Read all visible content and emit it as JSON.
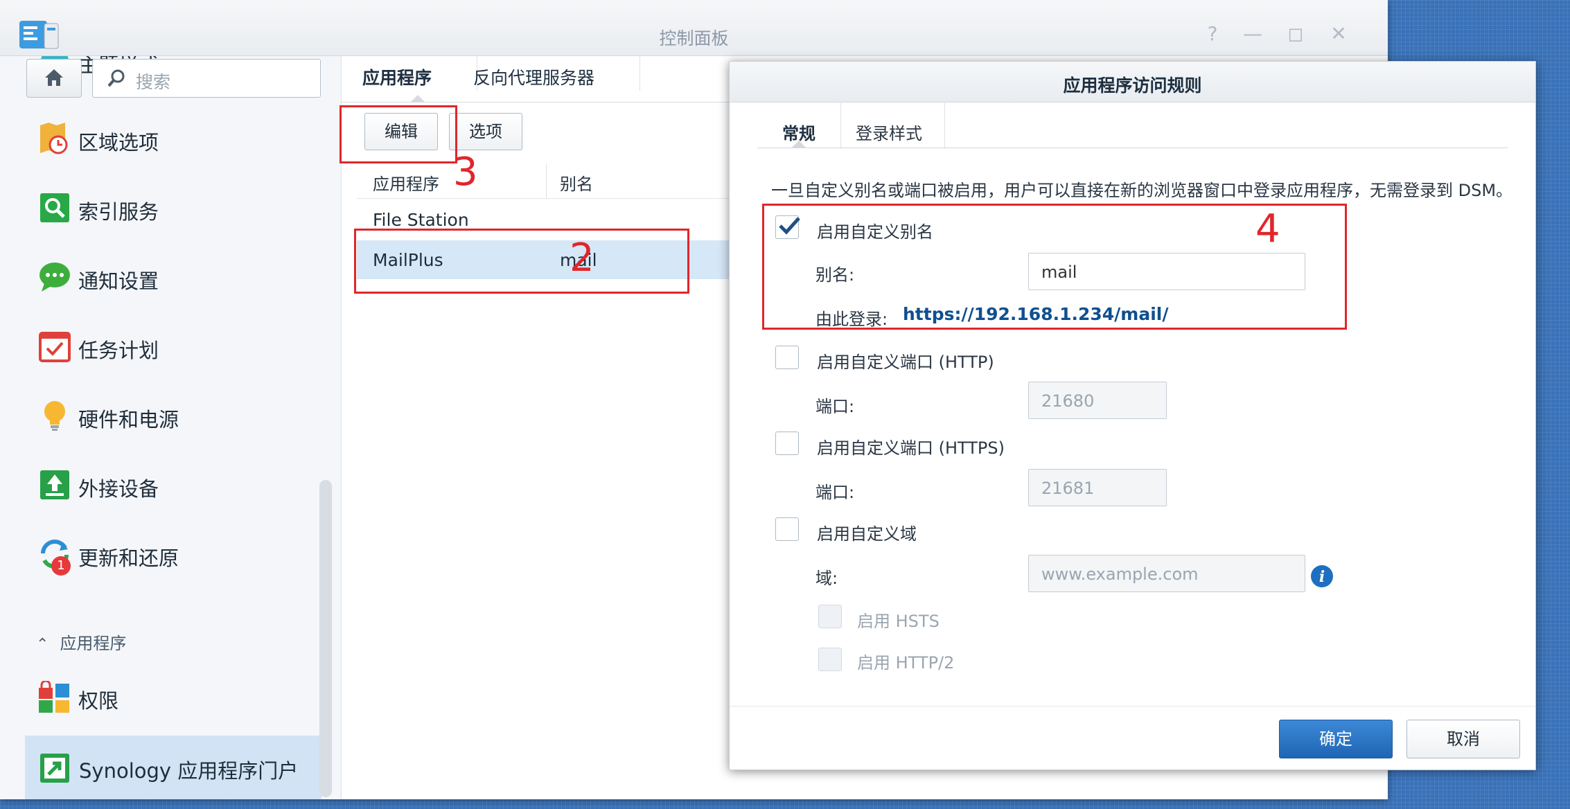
{
  "window": {
    "title": "控制面板"
  },
  "search": {
    "placeholder": "搜索"
  },
  "sidebar": {
    "partial_item": "主题样式",
    "items": [
      {
        "label": "区域选项",
        "icon": "clock-map-icon"
      },
      {
        "label": "索引服务",
        "icon": "index-search-icon"
      },
      {
        "label": "通知设置",
        "icon": "chat-bubble-icon"
      },
      {
        "label": "任务计划",
        "icon": "calendar-check-icon"
      },
      {
        "label": "硬件和电源",
        "icon": "lightbulb-icon"
      },
      {
        "label": "外接设备",
        "icon": "upload-arrow-icon"
      },
      {
        "label": "更新和还原",
        "icon": "refresh-icon",
        "badge": "1"
      }
    ],
    "section": "应用程序",
    "section_items": [
      {
        "label": "权限",
        "icon": "lock-grid-icon"
      },
      {
        "label": "Synology 应用程序门户",
        "icon": "portal-arrow-icon",
        "active": true
      }
    ]
  },
  "content": {
    "tabs": [
      "应用程序",
      "反向代理服务器"
    ],
    "toolbar": {
      "edit": "编辑",
      "options": "选项"
    },
    "columns": [
      "应用程序",
      "别名"
    ],
    "rows": [
      {
        "app": "File Station",
        "alias": ""
      },
      {
        "app": "MailPlus",
        "alias": "mail",
        "selected": true
      }
    ]
  },
  "annotations": [
    "2",
    "3",
    "4"
  ],
  "dialog": {
    "title": "应用程序访问规则",
    "tabs": [
      "常规",
      "登录样式"
    ],
    "description": "一旦自定义别名或端口被启用，用户可以直接在新的浏览器窗口中登录应用程序，无需登录到 DSM。",
    "alias_section": {
      "checkbox_label": "启用自定义别名",
      "checked": true,
      "alias_label": "别名:",
      "alias_value": "mail",
      "login_label": "由此登录:",
      "login_url": "https://192.168.1.234/mail/"
    },
    "http_section": {
      "checkbox_label": "启用自定义端口 (HTTP)",
      "checked": false,
      "port_label": "端口:",
      "port_value": "21680"
    },
    "https_section": {
      "checkbox_label": "启用自定义端口 (HTTPS)",
      "checked": false,
      "port_label": "端口:",
      "port_value": "21681"
    },
    "domain_section": {
      "checkbox_label": "启用自定义域",
      "checked": false,
      "domain_label": "域:",
      "domain_placeholder": "www.example.com",
      "hsts_label": "启用 HSTS",
      "http2_label": "启用 HTTP/2"
    },
    "buttons": {
      "ok": "确定",
      "cancel": "取消"
    }
  },
  "colors": {
    "accent": "#1e6fc0",
    "annotation": "#e0262b",
    "selected_row": "#d6e7f7",
    "link": "#0f4f8f"
  }
}
